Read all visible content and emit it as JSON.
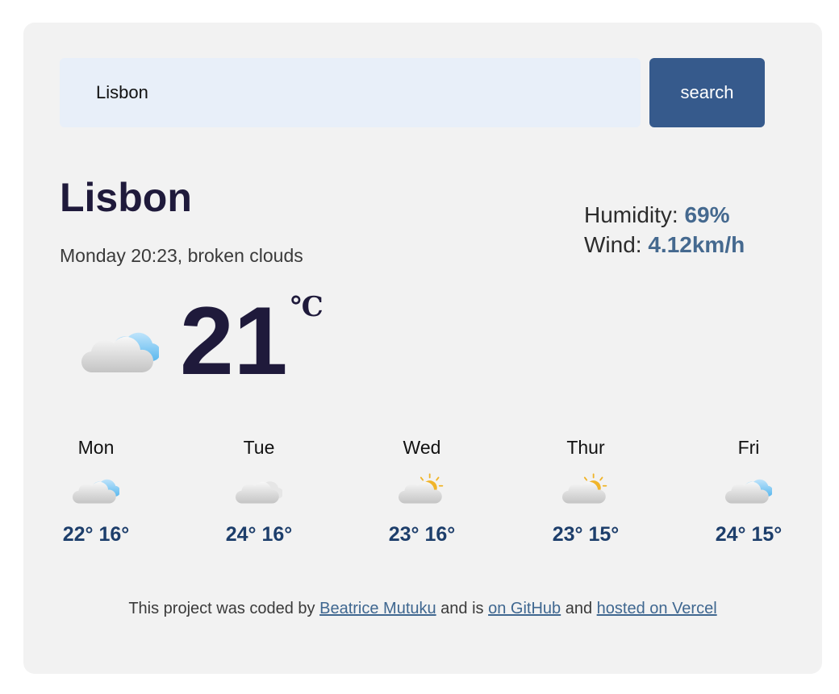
{
  "search": {
    "value": "Lisbon",
    "button_label": "search"
  },
  "current": {
    "city": "Lisbon",
    "day_time": "Monday 20:23",
    "separator": ", ",
    "condition": "broken clouds",
    "temperature": "21",
    "unit": "℃",
    "icon": "broken-clouds-icon",
    "humidity_label": "Humidity: ",
    "humidity_value": "69%",
    "wind_label": "Wind: ",
    "wind_value": "4.12km/h"
  },
  "forecast": [
    {
      "day": "Mon",
      "icon": "broken-clouds-icon",
      "temps": "22° 16°"
    },
    {
      "day": "Tue",
      "icon": "cloud-icon",
      "temps": "24° 16°"
    },
    {
      "day": "Wed",
      "icon": "partly-cloudy-icon",
      "temps": "23° 16°"
    },
    {
      "day": "Thur",
      "icon": "partly-cloudy-icon",
      "temps": "23° 15°"
    },
    {
      "day": "Fri",
      "icon": "broken-clouds-icon",
      "temps": "24° 15°"
    }
  ],
  "footer": {
    "text_1": "This project was coded by ",
    "author_link": "Beatrice Mutuku",
    "text_2": " and is ",
    "github_link": "on GitHub",
    "text_3": " and ",
    "vercel_link": "hosted on Vercel"
  },
  "colors": {
    "accent": "#365a8c",
    "card_background": "#f2f2f2",
    "input_background": "#e8eff9",
    "heading": "#1f1a3b",
    "value_highlight": "#45698f",
    "forecast_temp": "#1d3e6b"
  }
}
